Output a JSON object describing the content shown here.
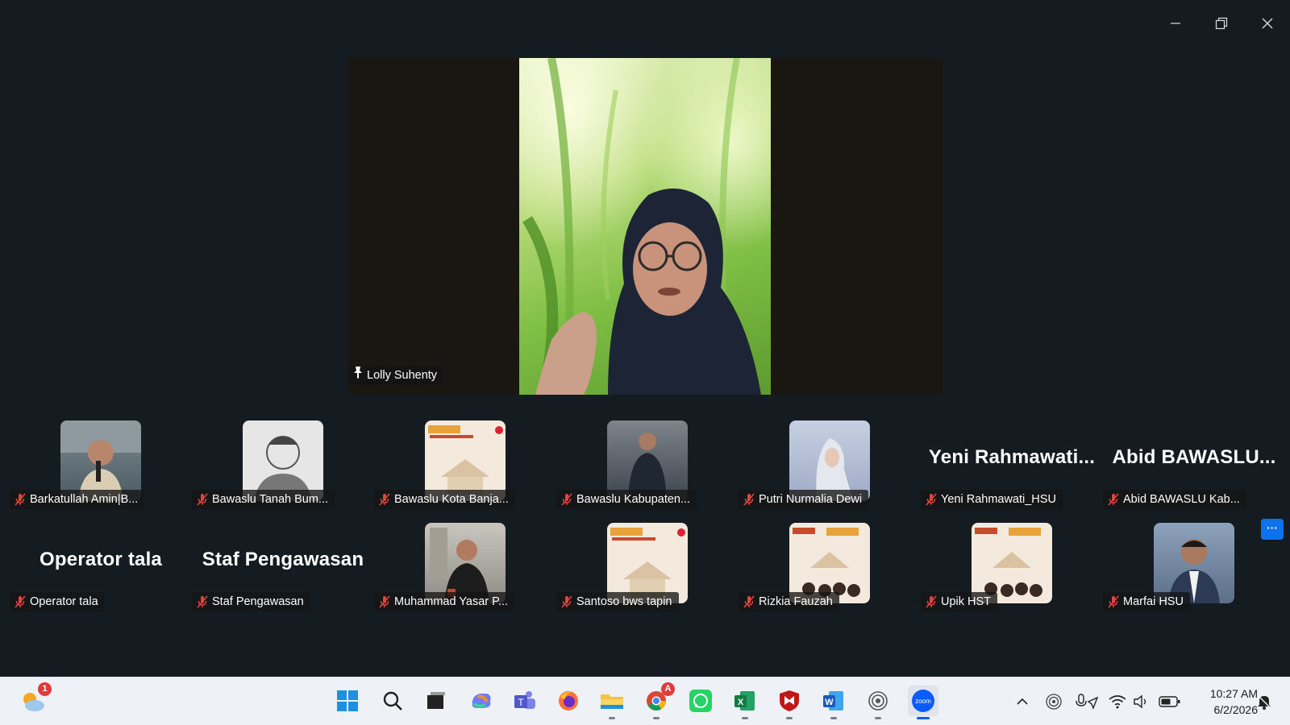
{
  "speaker": {
    "name": "Lolly Suhenty"
  },
  "gallery": [
    {
      "name": "Barkatullah Amin|B...",
      "thumb": "photo",
      "bg": "#6a7a82"
    },
    {
      "name": "Bawaslu Tanah Bum...",
      "thumb": "sketch",
      "bg": "#d9d9d9"
    },
    {
      "name": "Bawaslu Kota Banja...",
      "thumb": "kickoff",
      "bg": "#f2e6d6"
    },
    {
      "name": "Bawaslu Kabupaten...",
      "thumb": "photo",
      "bg": "#5d6570"
    },
    {
      "name": "Putri Nurmalia Dewi",
      "thumb": "hijab",
      "bg": "#b6c2d8"
    },
    {
      "name": "Yeni Rahmawati_HSU",
      "display": "Yeni  Rahmawati..."
    },
    {
      "name": "Abid BAWASLU Kab...",
      "display": "Abid  BAWASLU..."
    },
    {
      "name": "Operator tala",
      "display": "Operator tala"
    },
    {
      "name": "Staf Pengawasan",
      "display": "Staf Pengawasan"
    },
    {
      "name": "Muhammad Yasar P...",
      "thumb": "photo",
      "bg": "#8a8f96"
    },
    {
      "name": "Santoso bws tapin",
      "thumb": "kickoff",
      "bg": "#f2e6d6"
    },
    {
      "name": "Rizkia Fauzah",
      "thumb": "kickoff",
      "bg": "#f2e6d6"
    },
    {
      "name": "Upik HST",
      "thumb": "kickoff",
      "bg": "#f2e6d6"
    },
    {
      "name": "Marfai HSU",
      "thumb": "photo",
      "bg": "#7a8fa8"
    }
  ],
  "more_label": "···",
  "taskbar": {
    "weather_badge": "1",
    "chrome_badge": "A",
    "zoom_label": "zoom",
    "time": "10:27 AM",
    "date": "6/2/2026"
  },
  "colors": {
    "background": "#141c22",
    "mute": "#e0453c",
    "accent": "#0e72ed"
  }
}
